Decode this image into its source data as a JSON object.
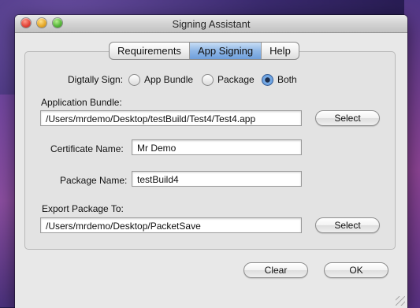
{
  "window": {
    "title": "Signing Assistant"
  },
  "tabs": [
    {
      "label": "Requirements",
      "active": false
    },
    {
      "label": "App Signing",
      "active": true
    },
    {
      "label": "Help",
      "active": false
    }
  ],
  "sign": {
    "label": "Digtally Sign:",
    "options": [
      "App Bundle",
      "Package",
      "Both"
    ],
    "selected": "Both"
  },
  "app_bundle": {
    "label": "Application Bundle:",
    "value": "/Users/mrdemo/Desktop/testBuild/Test4/Test4.app",
    "select_label": "Select"
  },
  "certificate": {
    "label": "Certificate Name:",
    "value": "Mr Demo"
  },
  "package": {
    "label": "Package Name:",
    "value": "testBuild4"
  },
  "export": {
    "label": "Export Package To:",
    "value": "/Users/mrdemo/Desktop/PacketSave",
    "select_label": "Select"
  },
  "footer": {
    "clear_label": "Clear",
    "ok_label": "OK"
  }
}
